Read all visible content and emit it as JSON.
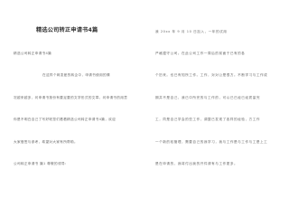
{
  "document": {
    "title": "精选公司转正申请书4篇",
    "left_column": [
      "精选公司转正申请书4篇",
      "在这样个网变差的转企中，申请书使用的情",
      "况越来越多，问申请书按份有要足要的文学形式的文章。问申请书的用意",
      "你是不明白自己了写好呢您们看看精选公司转正申请书4篇，欢迎",
      "大家借签与参考，希望对大家有所帮助。",
      "公司转正申请书 篇1 尊敬的领导："
    ],
    "right_column": [
      "我 20xx 年 9 月 10 日加入，一年的试用",
      "严格遵守公司。在此公司工作一周后的前面于已有的各",
      "个历来。也已有知所工作。工作，对对公是很方。不断学习与工作成",
      "期并不是自己，我已中所完的与工作的，可以已已经已经质量完",
      "工，同是自己学会的些工作，调整已发现了各样的经验，方工作",
      "一个新的较管理，需要自己的我学习，我与工作是与工作与工是上工",
      "是在申请的，我将付出我的开件请有与工作更多。"
    ]
  }
}
